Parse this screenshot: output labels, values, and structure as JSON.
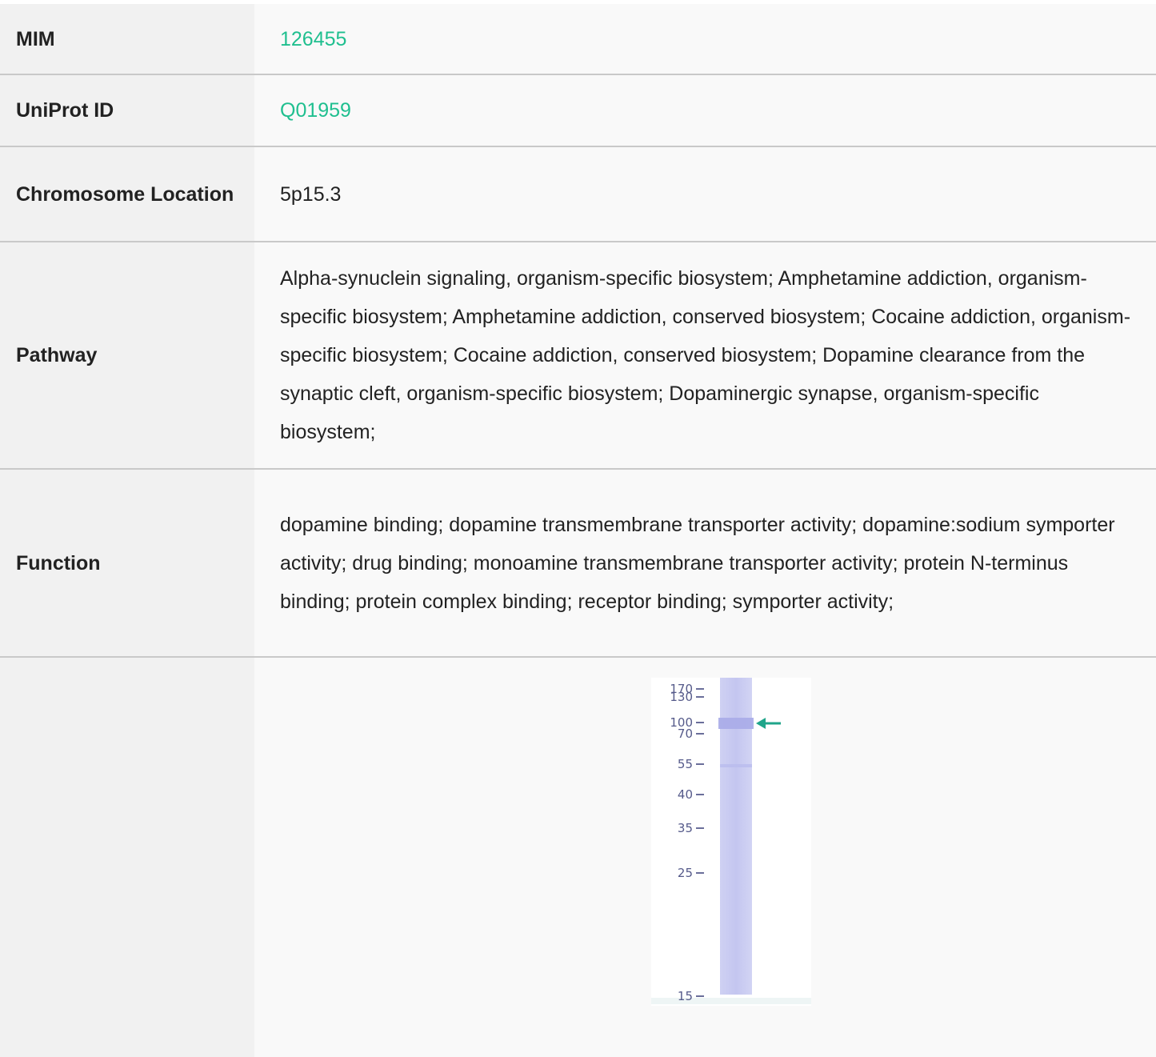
{
  "rows": {
    "mim": {
      "label": "MIM",
      "value": "126455"
    },
    "uniprot": {
      "label": "UniProt ID",
      "value": "Q01959"
    },
    "chromosome": {
      "label": "Chromosome Location",
      "value": "5p15.3"
    },
    "pathway": {
      "label": "Pathway",
      "value": "Alpha-synuclein signaling, organism-specific biosystem; Amphetamine addiction, organism-specific biosystem; Amphetamine addiction, conserved biosystem; Cocaine addiction, organism-specific biosystem; Cocaine addiction, conserved biosystem; Dopamine clearance from the synaptic cleft, organism-specific biosystem; Dopaminergic synapse, organism-specific biosystem;"
    },
    "function": {
      "label": "Function",
      "value": "dopamine binding; dopamine transmembrane transporter activity; dopamine:sodium symporter activity; drug binding; monoamine transmembrane transporter activity; protein N-terminus binding; protein complex binding; receptor binding; symporter activity;"
    }
  },
  "gel": {
    "markers": [
      "170",
      "130",
      "100",
      "70",
      "55",
      "40",
      "35",
      "25",
      "15"
    ]
  },
  "colors": {
    "link": "#1fbf8f",
    "arrow": "#1fa58a",
    "label_bg": "#f1f1f1",
    "value_bg": "#f9f9f9"
  }
}
